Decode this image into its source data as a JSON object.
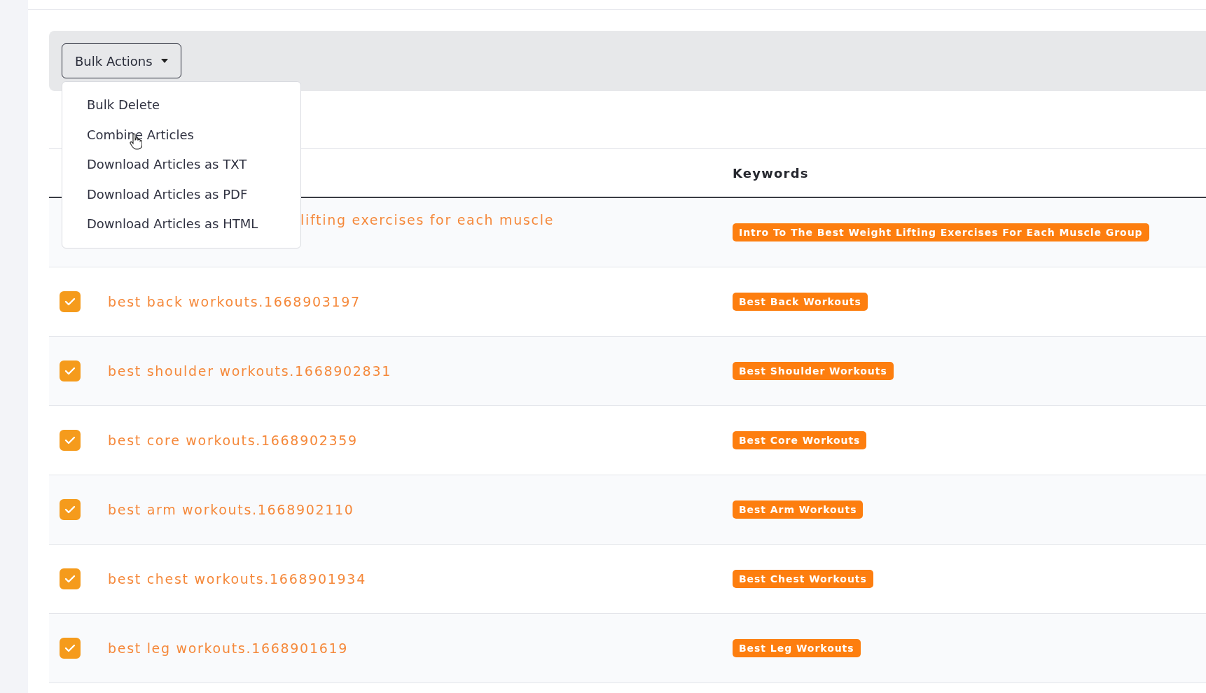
{
  "bulk_actions": {
    "label": "Bulk Actions",
    "expanded": true,
    "menu": [
      {
        "label": "Bulk Delete",
        "hovered": false
      },
      {
        "label": "Combine Articles",
        "hovered": true
      },
      {
        "label": "Download Articles as TXT",
        "hovered": false
      },
      {
        "label": "Download Articles as PDF",
        "hovered": false
      },
      {
        "label": "Download Articles as HTML",
        "hovered": false
      }
    ]
  },
  "table": {
    "columns": [
      {
        "label": "Keywords"
      }
    ],
    "rows": [
      {
        "title": "lifting exercises for each muscle",
        "keyword": "Intro To The Best Weight Lifting Exercises For Each Muscle Group",
        "covered": true
      },
      {
        "title": "best back workouts.1668903197",
        "keyword": "Best Back Workouts",
        "checked": true,
        "covered": false
      },
      {
        "title": "best shoulder workouts.1668902831",
        "keyword": "Best Shoulder Workouts",
        "checked": true,
        "covered": false
      },
      {
        "title": "best core workouts.1668902359",
        "keyword": "Best Core Workouts",
        "checked": true,
        "covered": false
      },
      {
        "title": "best arm workouts.1668902110",
        "keyword": "Best Arm Workouts",
        "checked": true,
        "covered": false
      },
      {
        "title": "best chest workouts.1668901934",
        "keyword": "Best Chest Workouts",
        "checked": true,
        "covered": false
      },
      {
        "title": "best leg workouts.1668901619",
        "keyword": "Best Leg Workouts",
        "checked": true,
        "covered": false
      }
    ]
  }
}
